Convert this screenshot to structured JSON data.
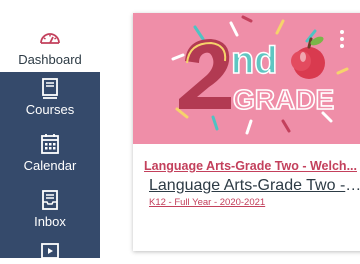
{
  "nav": {
    "dashboard": {
      "label": "Dashboard",
      "icon": "dashboard-gauge-icon"
    },
    "courses": {
      "label": "Courses",
      "icon": "book-icon"
    },
    "calendar": {
      "label": "Calendar",
      "icon": "calendar-icon"
    },
    "inbox": {
      "label": "Inbox",
      "icon": "inbox-icon"
    },
    "history": {
      "icon": "history-icon"
    }
  },
  "course_card": {
    "hero_image": "2nd grade banner with apple",
    "hero_text_big": "2",
    "hero_text_small": "nd",
    "hero_text_grade": "GRADE",
    "title": "Language Arts-Grade Two - Welch...",
    "name": "Language Arts-Grade Two - W...",
    "term": "K12 - Full Year - 2020-2021"
  },
  "colors": {
    "sidebar": "#354a6b",
    "card_hero": "#ef8ea8",
    "card_title": "#c3405c",
    "text_dark": "#2d3b45"
  }
}
